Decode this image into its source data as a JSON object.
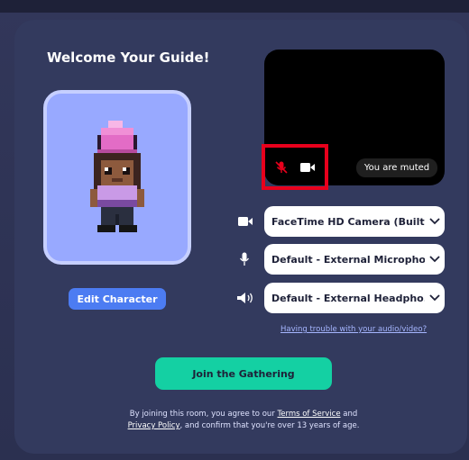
{
  "page": {
    "title": "Welcome Your Guide!",
    "edit_character_label": "Edit Character",
    "preview": {
      "muted_text": "You are muted"
    },
    "devices": {
      "camera": "FaceTime HD Camera (Built...",
      "microphone": "Default - External Micropho...",
      "speaker": "Default - External Headpho..."
    },
    "help_link": "Having trouble with your audio/video?",
    "join_label": "Join the Gathering",
    "legal": {
      "part1": "By joining this room, you agree to our ",
      "terms": "Terms of Service",
      "part2": " and",
      "privacy": "Privacy Policy",
      "part3": ", and confirm that you're over 13 years of age."
    }
  },
  "colors": {
    "card_bg": "#333a5e",
    "avatar_bg": "#98a9ff",
    "edit_button": "#4c7cf2",
    "join_button": "#14d0a3",
    "highlight": "#e8001c"
  },
  "icons": {
    "mic_off": "mic-off-icon",
    "camera": "camera-icon",
    "microphone": "microphone-icon",
    "speaker": "speaker-icon",
    "chevron": "chevron-down-icon"
  }
}
